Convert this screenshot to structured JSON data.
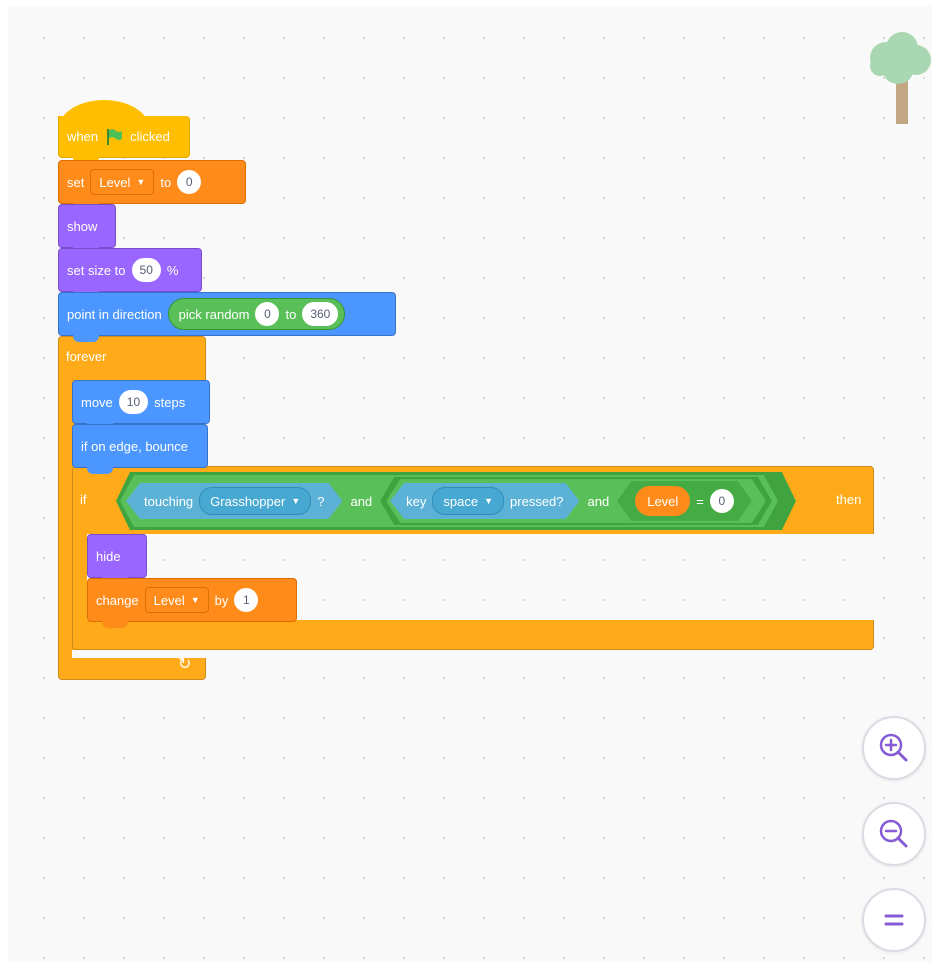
{
  "script": {
    "when_flag": {
      "word1": "when",
      "word2": "clicked",
      "icon": "green-flag-icon"
    },
    "set_var": {
      "label": "set",
      "var": "Level",
      "to": "to",
      "value": "0"
    },
    "show": {
      "label": "show"
    },
    "set_size": {
      "label": "set size to",
      "value": "50",
      "unit": "%"
    },
    "point_dir": {
      "label": "point in direction",
      "pick_random": "pick random",
      "from": "0",
      "to_label": "to",
      "to": "360"
    },
    "forever": {
      "label": "forever",
      "loop_icon": "loop-arrow-icon"
    },
    "move": {
      "label": "move",
      "value": "10",
      "unit": "steps"
    },
    "bounce": {
      "label": "if on edge, bounce"
    },
    "if_block": {
      "if_label": "if",
      "touching": "touching",
      "touching_target": "Grasshopper",
      "question": "?",
      "and1": "and",
      "key": "key",
      "key_name": "space",
      "pressed": "pressed?",
      "and2": "and",
      "var": "Level",
      "equals": "=",
      "eq_value": "0",
      "then": "then"
    },
    "hide": {
      "label": "hide"
    },
    "change": {
      "label": "change",
      "var": "Level",
      "by": "by",
      "value": "1"
    }
  },
  "zoom": {
    "zoom_in_icon": "zoom-in-icon",
    "zoom_out_icon": "zoom-out-icon",
    "reset_icon": "zoom-reset-icon"
  },
  "colors": {
    "events": "#ffbf00",
    "variables": "#ff8c1a",
    "looks": "#9966ff",
    "motion": "#4c97ff",
    "control": "#ffab19",
    "operators": "#59c059",
    "sensing": "#5cb1d6"
  }
}
